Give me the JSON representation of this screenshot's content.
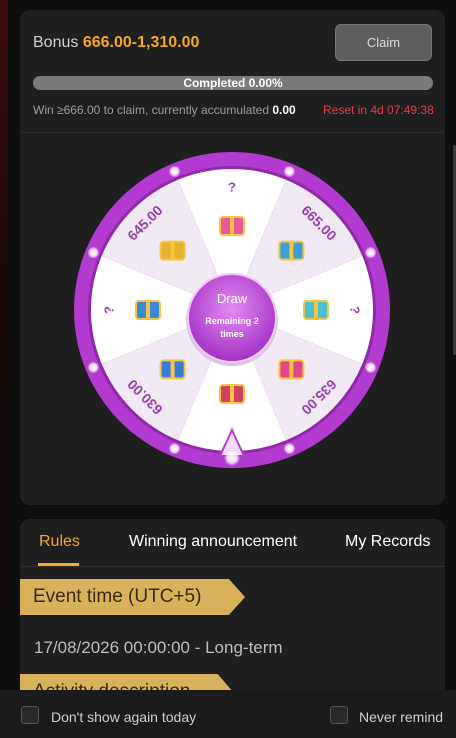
{
  "bonus": {
    "label": "Bonus",
    "range": "666.00-1,310.00"
  },
  "claim_label": "Claim",
  "progress": {
    "text": "Completed 0.00%",
    "fraction": 0.0
  },
  "hint": {
    "text": "Win ≥666.00 to claim, currently accumulated",
    "value": "0.00"
  },
  "reset": "Reset in 4d 07:49:38",
  "wheel": {
    "draw_label": "Draw",
    "remaining_label": "Remaining",
    "remaining_count": "2",
    "times_label": "times",
    "segments": [
      "?",
      "665.00",
      "?",
      "635.00",
      "",
      "630.00",
      "?",
      "645.00"
    ],
    "colors": {
      "rim": "#b23ad1",
      "segment_light": "#ffffff",
      "segment_dark": "#f1e9f4",
      "text": "#9a3fb0",
      "accent": "#f5a623"
    }
  },
  "tabs": {
    "rules": "Rules",
    "winning": "Winning announcement",
    "records": "My Records"
  },
  "rules": {
    "event_time_heading": "Event time (UTC+5)",
    "event_time_value": "17/08/2026 00:00:00 - Long-term",
    "activity_heading": "Activity description"
  },
  "footer": {
    "dont_show": "Don't show again today",
    "never_remind": "Never remind"
  }
}
